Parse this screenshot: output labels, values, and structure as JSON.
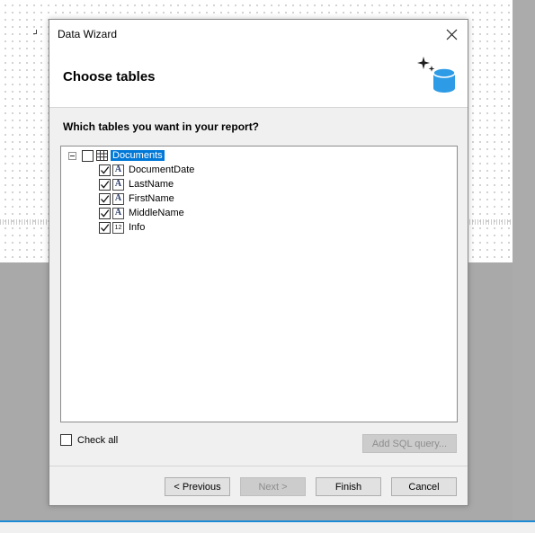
{
  "dialog": {
    "title": "Data Wizard",
    "header_title": "Choose tables",
    "question": "Which tables you want in your report?"
  },
  "tree": {
    "root": {
      "label": "Documents",
      "checked": false,
      "expanded": true,
      "selected": true,
      "icon": "table-icon"
    },
    "fields": [
      {
        "label": "DocumentDate",
        "checked": true,
        "type_icon": "A"
      },
      {
        "label": "LastName",
        "checked": true,
        "type_icon": "A"
      },
      {
        "label": "FirstName",
        "checked": true,
        "type_icon": "A"
      },
      {
        "label": "MiddleName",
        "checked": true,
        "type_icon": "A"
      },
      {
        "label": "Info",
        "checked": true,
        "type_icon": "12"
      }
    ]
  },
  "controls": {
    "check_all_label": "Check all",
    "add_sql_label": "Add SQL query...",
    "previous_label": "< Previous",
    "next_label": "Next >",
    "finish_label": "Finish",
    "cancel_label": "Cancel"
  },
  "colors": {
    "selection": "#0078d7",
    "accent_line": "#1d8ad6",
    "db_icon": "#2e9be6"
  }
}
